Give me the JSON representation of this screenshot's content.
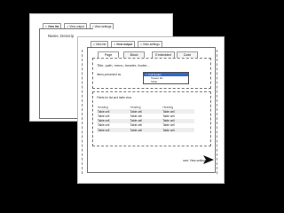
{
  "back_sheet": {
    "tabs": [
      "View list",
      "View output",
      "View settings"
    ],
    "active_index": 0,
    "name_text": "Name, Descrip"
  },
  "front_sheet": {
    "tabs": [
      "View list",
      "View output",
      "View settings"
    ],
    "active_index": 1,
    "subtabs": [
      "Page",
      "Block",
      "Embedded",
      "Code"
    ],
    "sub_active_index": 0,
    "section1": {
      "fields_text": "Title, path, menu, header, footer...",
      "items_label": "Items presented as",
      "dropdown": {
        "options": [
          "Full Nodes",
          "Teaser list",
          "Table"
        ],
        "selected_index": 0
      }
    },
    "section2": {
      "title": "Fields for list and table view",
      "table": {
        "headers": [
          "Heading",
          "Heading",
          "Heading"
        ],
        "rows": [
          [
            "Table cell",
            "Table cell",
            "Table cell"
          ],
          [
            "Table cell",
            "Table cell",
            "Table cell"
          ],
          [
            "Table cell",
            "Table cell",
            "Table cell"
          ],
          [
            "Table cell",
            "Table cell",
            "Table cell"
          ],
          [
            "Table cell",
            "Table cell",
            "Table cell"
          ]
        ]
      }
    },
    "next_label": "next: View settings"
  },
  "icons": {
    "tab_close": "×",
    "check": "✓"
  }
}
